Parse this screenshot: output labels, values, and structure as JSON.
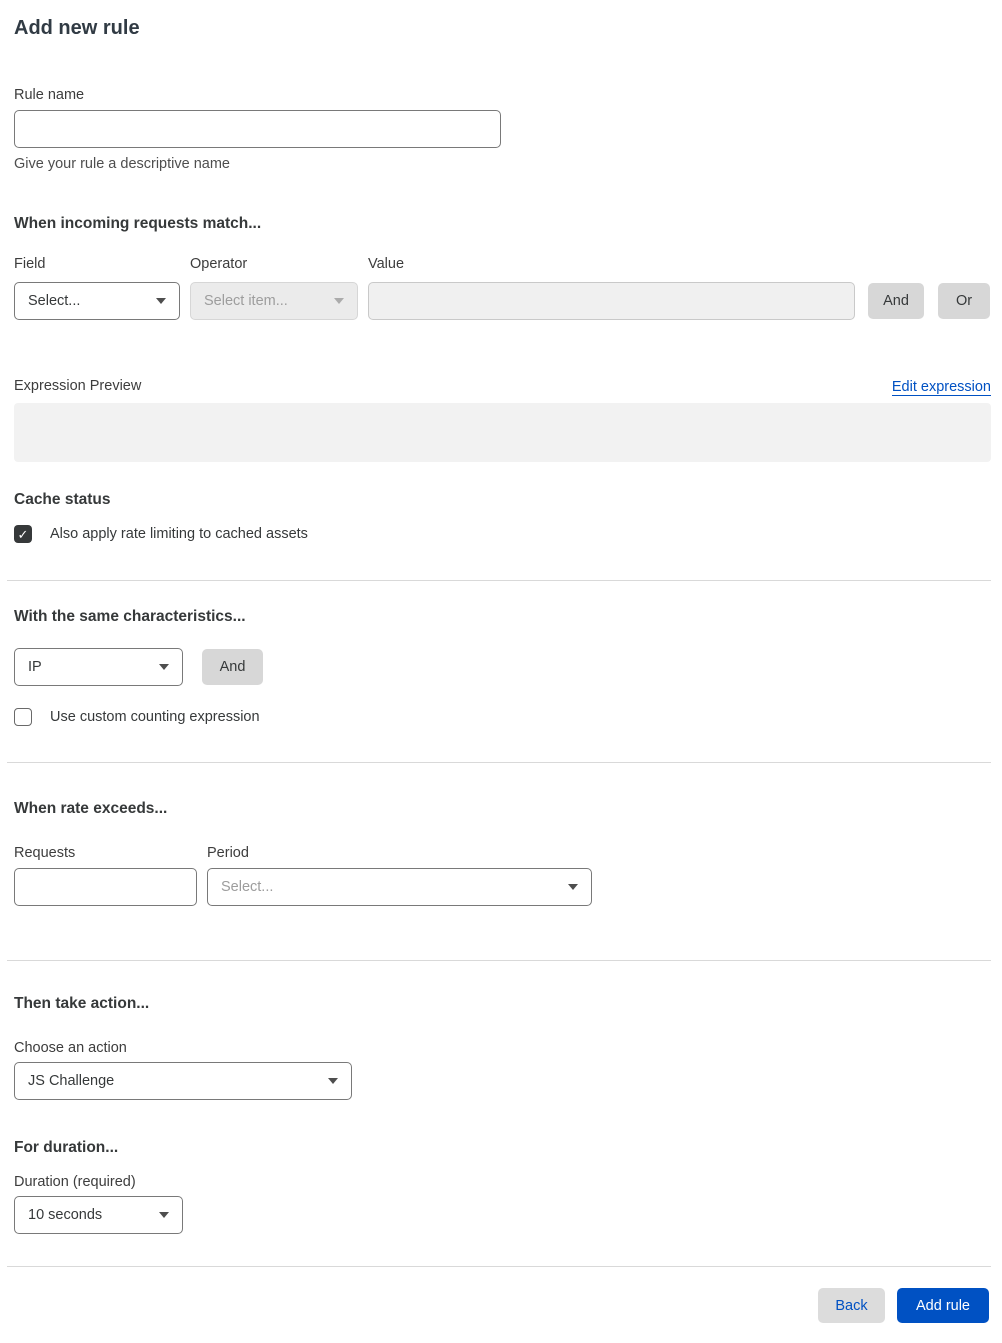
{
  "page": {
    "title": "Add new rule"
  },
  "colors": {
    "accent": "#0051c3",
    "text": "#36393a",
    "disabled_bg": "#ebebeb",
    "preview_bg": "#f2f2f2",
    "button_gray": "#d7d7d7"
  },
  "rule_name": {
    "label": "Rule name",
    "value": "",
    "placeholder": "",
    "helper": "Give your rule a descriptive name"
  },
  "match_section": {
    "title": "When incoming requests match...",
    "field": {
      "label": "Field",
      "value": "Select..."
    },
    "operator": {
      "label": "Operator",
      "value": "Select item..."
    },
    "value": {
      "label": "Value",
      "value": "",
      "placeholder": ""
    },
    "and_button": "And",
    "or_button": "Or",
    "expression_preview": {
      "label": "Expression Preview",
      "edit_link": "Edit expression",
      "content": ""
    }
  },
  "cache_status": {
    "title": "Cache status",
    "checkbox_label": "Also apply rate limiting to cached assets",
    "checked": true,
    "check_glyph": "✓"
  },
  "characteristics": {
    "title": "With the same characteristics...",
    "select_value": "IP",
    "and_button": "And",
    "counting_checkbox_label": "Use custom counting expression",
    "counting_checked": false
  },
  "rate_section": {
    "title": "When rate exceeds...",
    "requests": {
      "label": "Requests",
      "value": "",
      "placeholder": ""
    },
    "period": {
      "label": "Period",
      "value": "Select..."
    }
  },
  "action_section": {
    "title": "Then take action...",
    "label": "Choose an action",
    "value": "JS Challenge"
  },
  "duration_section": {
    "title": "For duration...",
    "label": "Duration (required)",
    "value": "10 seconds"
  },
  "footer": {
    "back_button": "Back",
    "submit_button": "Add rule"
  }
}
